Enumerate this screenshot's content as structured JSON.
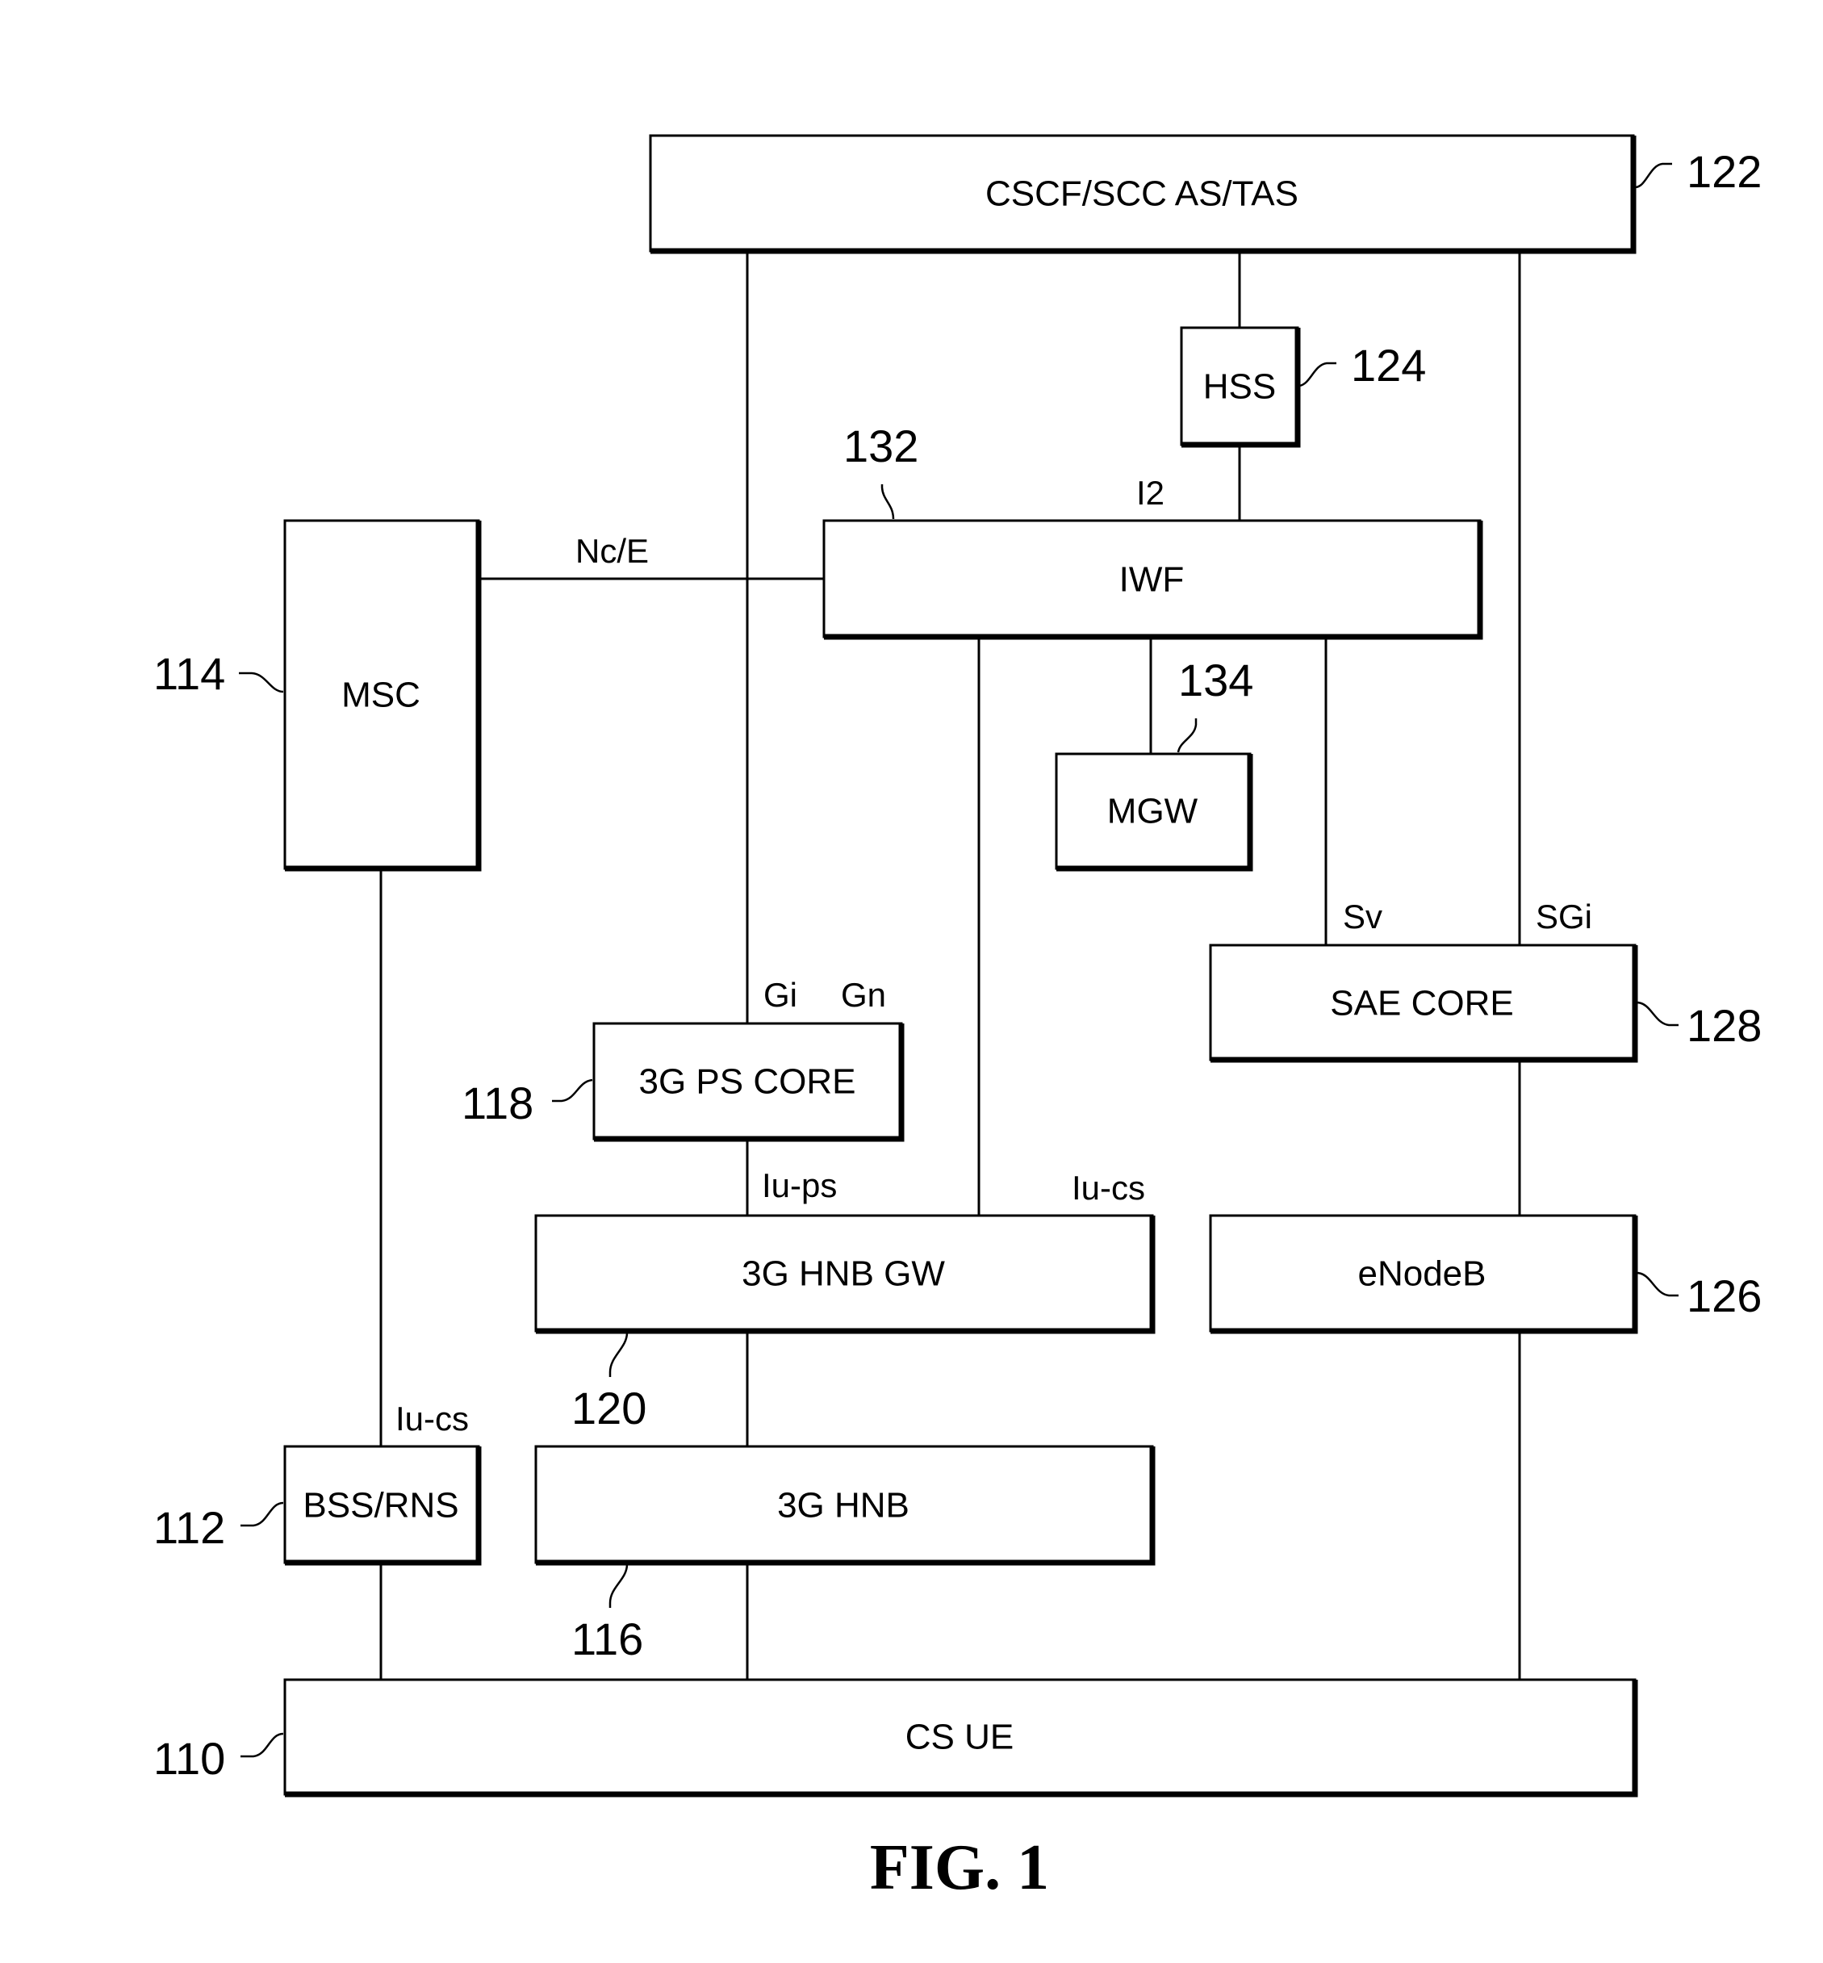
{
  "figure": {
    "caption": "FIG. 1",
    "nodes": [
      {
        "id": "cscf",
        "label": "CSCF/SCC AS/TAS",
        "ref": "122"
      },
      {
        "id": "hss",
        "label": "HSS",
        "ref": "124"
      },
      {
        "id": "iwf",
        "label": "IWF",
        "ref": "132"
      },
      {
        "id": "msc",
        "label": "MSC",
        "ref": "114"
      },
      {
        "id": "mgw",
        "label": "MGW",
        "ref": "134"
      },
      {
        "id": "sae",
        "label": "SAE CORE",
        "ref": "128"
      },
      {
        "id": "ps",
        "label": "3G PS CORE",
        "ref": "118"
      },
      {
        "id": "hnbgw",
        "label": "3G HNB GW",
        "ref": "120"
      },
      {
        "id": "enodeb",
        "label": "eNodeB",
        "ref": "126"
      },
      {
        "id": "bss",
        "label": "BSS/RNS",
        "ref": "112"
      },
      {
        "id": "hnb",
        "label": "3G HNB",
        "ref": "116"
      },
      {
        "id": "ue",
        "label": "CS UE",
        "ref": "110"
      }
    ],
    "interfaces": {
      "i2": "I2",
      "nce": "Nc/E",
      "sv": "Sv",
      "sgi": "SGi",
      "gi": "Gi",
      "gn": "Gn",
      "iups": "Iu-ps",
      "iucs_hnbgw": "Iu-cs",
      "iucs_bss": "Iu-cs"
    },
    "connections": [
      {
        "from": "cscf",
        "to": "hss"
      },
      {
        "from": "hss",
        "to": "iwf",
        "interface": "I2"
      },
      {
        "from": "cscf",
        "to": "ps",
        "interface": "Gi"
      },
      {
        "from": "cscf",
        "to": "sae",
        "interface": "SGi"
      },
      {
        "from": "msc",
        "to": "iwf",
        "interface": "Nc/E"
      },
      {
        "from": "iwf",
        "to": "mgw"
      },
      {
        "from": "iwf",
        "to": "sae",
        "interface": "Sv"
      },
      {
        "from": "iwf",
        "to": "hnbgw",
        "interface": "Iu-cs"
      },
      {
        "from": "ps",
        "to": "hnbgw",
        "interface": "Iu-ps"
      },
      {
        "from": "msc",
        "to": "bss",
        "interface": "Iu-cs"
      },
      {
        "from": "sae",
        "to": "enodeb"
      },
      {
        "from": "hnbgw",
        "to": "hnb"
      },
      {
        "from": "bss",
        "to": "ue"
      },
      {
        "from": "hnb",
        "to": "ue"
      },
      {
        "from": "enodeb",
        "to": "ue"
      }
    ]
  }
}
